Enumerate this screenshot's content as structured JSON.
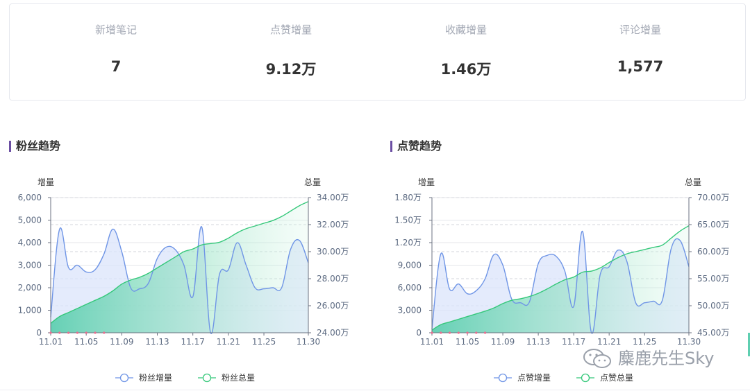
{
  "stats": [
    {
      "label": "新增笔记",
      "value": "7"
    },
    {
      "label": "点赞增量",
      "value": "9.12万"
    },
    {
      "label": "收藏增量",
      "value": "1.46万"
    },
    {
      "label": "评论增量",
      "value": "1,577"
    }
  ],
  "sections": [
    {
      "title": "粉丝趋势"
    },
    {
      "title": "点赞趋势"
    }
  ],
  "watermark": "麋鹿先生Sky",
  "colors": {
    "increment": "#6f95e6",
    "total": "#35c87a",
    "accent": "#6b4ea3",
    "marker": "#e86e8f"
  },
  "chart_data": [
    {
      "type": "line",
      "left_axis_name": "增量",
      "right_axis_name": "总量",
      "x": [
        "11.01",
        "11.02",
        "11.03",
        "11.04",
        "11.05",
        "11.06",
        "11.07",
        "11.08",
        "11.09",
        "11.10",
        "11.11",
        "11.12",
        "11.13",
        "11.14",
        "11.15",
        "11.16",
        "11.17",
        "11.18",
        "11.19",
        "11.20",
        "11.21",
        "11.22",
        "11.23",
        "11.24",
        "11.25",
        "11.26",
        "11.27",
        "11.28",
        "11.29",
        "11.30"
      ],
      "x_tick_labels": [
        "11.01",
        "11.05",
        "11.09",
        "11.13",
        "11.17",
        "11.21",
        "11.25",
        "11.30"
      ],
      "left_ticks": [
        "0",
        "1,000",
        "2,000",
        "3,000",
        "4,000",
        "5,000",
        "6,000"
      ],
      "right_ticks": [
        "24.00万",
        "26.00万",
        "28.00万",
        "30.00万",
        "32.00万",
        "34.00万"
      ],
      "ylim_left": [
        0,
        6000
      ],
      "ylim_right": [
        24,
        34
      ],
      "series": [
        {
          "name": "粉丝增量",
          "axis": "left",
          "area": true,
          "values": [
            700,
            4600,
            2900,
            3000,
            2700,
            2800,
            3500,
            4600,
            3600,
            2000,
            1950,
            2200,
            3300,
            3800,
            3700,
            3000,
            1600,
            4700,
            0,
            2600,
            2800,
            4000,
            3000,
            2000,
            1950,
            2000,
            2000,
            3700,
            4100,
            3100
          ]
        },
        {
          "name": "粉丝总量",
          "axis": "right",
          "area": true,
          "values": [
            24.7,
            25.2,
            25.5,
            25.8,
            26.1,
            26.4,
            26.7,
            27.1,
            27.6,
            27.9,
            28.1,
            28.4,
            28.8,
            29.2,
            29.6,
            30.0,
            30.2,
            30.5,
            30.6,
            30.7,
            31.0,
            31.4,
            31.7,
            31.9,
            32.1,
            32.3,
            32.6,
            33.0,
            33.4,
            33.7
          ]
        }
      ]
    },
    {
      "type": "line",
      "left_axis_name": "增量",
      "right_axis_name": "总量",
      "x": [
        "11.01",
        "11.02",
        "11.03",
        "11.04",
        "11.05",
        "11.06",
        "11.07",
        "11.08",
        "11.09",
        "11.10",
        "11.11",
        "11.12",
        "11.13",
        "11.14",
        "11.15",
        "11.16",
        "11.17",
        "11.18",
        "11.19",
        "11.20",
        "11.21",
        "11.22",
        "11.23",
        "11.24",
        "11.25",
        "11.26",
        "11.27",
        "11.28",
        "11.29",
        "11.30"
      ],
      "x_tick_labels": [
        "11.01",
        "11.05",
        "11.09",
        "11.13",
        "11.17",
        "11.21",
        "11.25",
        "11.30"
      ],
      "left_ticks": [
        "0",
        "3,000",
        "6,000",
        "9,000",
        "1.20万",
        "1.50万",
        "1.80万"
      ],
      "right_ticks": [
        "45.00万",
        "50.00万",
        "55.00万",
        "60.00万",
        "65.00万",
        "70.00万"
      ],
      "ylim_left": [
        0,
        18000
      ],
      "ylim_right": [
        45,
        70
      ],
      "series": [
        {
          "name": "点赞增量",
          "axis": "left",
          "area": true,
          "values": [
            500,
            10500,
            5800,
            6500,
            5200,
            5600,
            7200,
            10400,
            9000,
            4500,
            4000,
            4100,
            9200,
            10300,
            10200,
            8200,
            3500,
            13500,
            0,
            7800,
            8800,
            11000,
            9500,
            4000,
            4000,
            4200,
            4300,
            11200,
            12300,
            8800
          ]
        },
        {
          "name": "点赞总量",
          "axis": "right",
          "area": true,
          "values": [
            45.5,
            46.5,
            47.0,
            47.5,
            48.0,
            48.5,
            49.0,
            49.6,
            50.4,
            51.0,
            51.3,
            51.7,
            52.3,
            53.1,
            54.0,
            54.8,
            55.3,
            56.2,
            56.4,
            57.0,
            58.0,
            58.9,
            59.6,
            60.0,
            60.4,
            60.8,
            61.2,
            62.5,
            63.8,
            64.8
          ]
        }
      ]
    }
  ]
}
